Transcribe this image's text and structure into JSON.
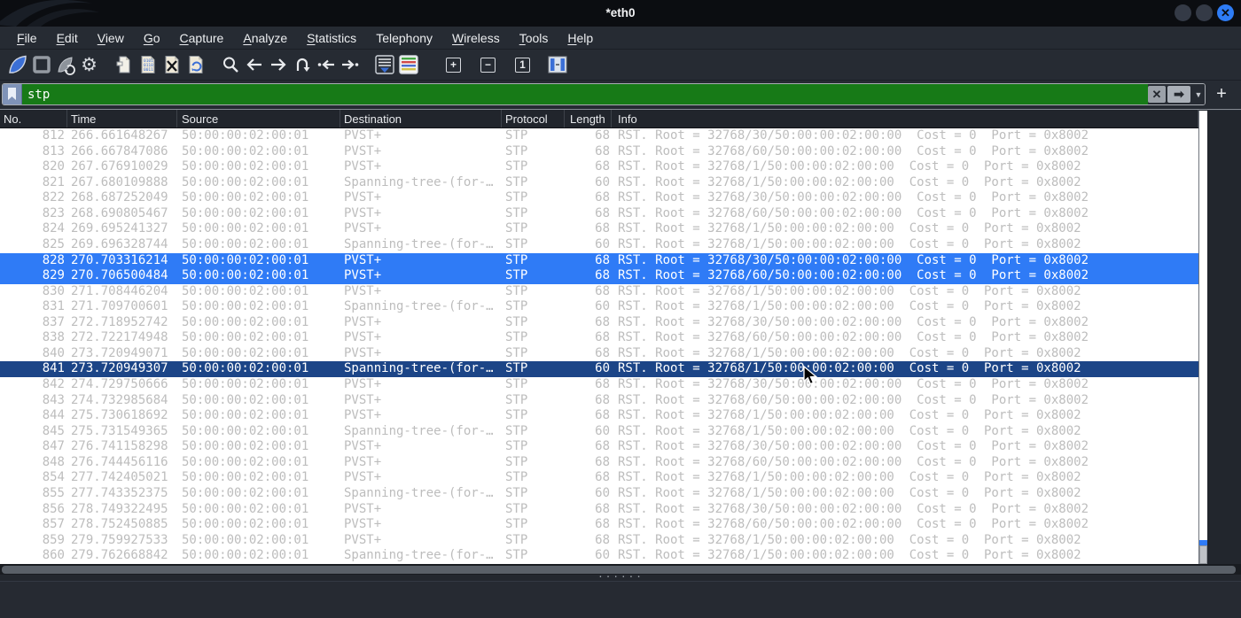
{
  "window": {
    "title": "*eth0",
    "controls": [
      "minimize",
      "maximize",
      "close"
    ],
    "close_glyph": "✕"
  },
  "menu": {
    "items": [
      {
        "label": "File",
        "mnemonic": 0
      },
      {
        "label": "Edit",
        "mnemonic": 0
      },
      {
        "label": "View",
        "mnemonic": 0
      },
      {
        "label": "Go",
        "mnemonic": 0
      },
      {
        "label": "Capture",
        "mnemonic": 0
      },
      {
        "label": "Analyze",
        "mnemonic": 0
      },
      {
        "label": "Statistics",
        "mnemonic": 0
      },
      {
        "label": "Telephony",
        "mnemonic": -1
      },
      {
        "label": "Wireless",
        "mnemonic": 0
      },
      {
        "label": "Tools",
        "mnemonic": 0
      },
      {
        "label": "Help",
        "mnemonic": 0
      }
    ]
  },
  "toolbar": {
    "buttons": [
      "start-capture",
      "stop-capture",
      "restart-capture",
      "capture-options",
      "open-file",
      "save-file",
      "close-file",
      "reload-file",
      "find-packet",
      "go-back",
      "go-forward",
      "go-to-packet",
      "go-first-packet",
      "go-last-packet",
      "auto-scroll",
      "colorize-packets",
      "zoom-in",
      "zoom-out",
      "zoom-original",
      "resize-columns"
    ],
    "zoom_in_glyph": "+",
    "zoom_out_glyph": "−",
    "zoom_original_glyph": "1",
    "gear_glyph": "⚙"
  },
  "filter": {
    "value": "stp",
    "clear_glyph": "✕",
    "apply_glyph": "➡",
    "caret_glyph": "▼",
    "add_glyph": "+"
  },
  "packet_table": {
    "columns": [
      "No.",
      "Time",
      "Source",
      "Destination",
      "Protocol",
      "Length",
      "Info"
    ],
    "rows": [
      {
        "no": "812",
        "time": "266.661648267",
        "source": "50:00:00:02:00:01",
        "destination": "PVST+",
        "protocol": "STP",
        "length": "68",
        "info": "RST. Root = 32768/30/50:00:00:02:00:00  Cost = 0  Port = 0x8002",
        "state": "normal"
      },
      {
        "no": "813",
        "time": "266.667847086",
        "source": "50:00:00:02:00:01",
        "destination": "PVST+",
        "protocol": "STP",
        "length": "68",
        "info": "RST. Root = 32768/60/50:00:00:02:00:00  Cost = 0  Port = 0x8002",
        "state": "normal"
      },
      {
        "no": "820",
        "time": "267.676910029",
        "source": "50:00:00:02:00:01",
        "destination": "PVST+",
        "protocol": "STP",
        "length": "68",
        "info": "RST. Root = 32768/1/50:00:00:02:00:00  Cost = 0  Port = 0x8002",
        "state": "normal"
      },
      {
        "no": "821",
        "time": "267.680109888",
        "source": "50:00:00:02:00:01",
        "destination": "Spanning-tree-(for-…",
        "protocol": "STP",
        "length": "60",
        "info": "RST. Root = 32768/1/50:00:00:02:00:00  Cost = 0  Port = 0x8002",
        "state": "normal"
      },
      {
        "no": "822",
        "time": "268.687252049",
        "source": "50:00:00:02:00:01",
        "destination": "PVST+",
        "protocol": "STP",
        "length": "68",
        "info": "RST. Root = 32768/30/50:00:00:02:00:00  Cost = 0  Port = 0x8002",
        "state": "normal"
      },
      {
        "no": "823",
        "time": "268.690805467",
        "source": "50:00:00:02:00:01",
        "destination": "PVST+",
        "protocol": "STP",
        "length": "68",
        "info": "RST. Root = 32768/60/50:00:00:02:00:00  Cost = 0  Port = 0x8002",
        "state": "normal"
      },
      {
        "no": "824",
        "time": "269.695241327",
        "source": "50:00:00:02:00:01",
        "destination": "PVST+",
        "protocol": "STP",
        "length": "68",
        "info": "RST. Root = 32768/1/50:00:00:02:00:00  Cost = 0  Port = 0x8002",
        "state": "normal"
      },
      {
        "no": "825",
        "time": "269.696328744",
        "source": "50:00:00:02:00:01",
        "destination": "Spanning-tree-(for-…",
        "protocol": "STP",
        "length": "60",
        "info": "RST. Root = 32768/1/50:00:00:02:00:00  Cost = 0  Port = 0x8002",
        "state": "normal"
      },
      {
        "no": "828",
        "time": "270.703316214",
        "source": "50:00:00:02:00:01",
        "destination": "PVST+",
        "protocol": "STP",
        "length": "68",
        "info": "RST. Root = 32768/30/50:00:00:02:00:00  Cost = 0  Port = 0x8002",
        "state": "selected"
      },
      {
        "no": "829",
        "time": "270.706500484",
        "source": "50:00:00:02:00:01",
        "destination": "PVST+",
        "protocol": "STP",
        "length": "68",
        "info": "RST. Root = 32768/60/50:00:00:02:00:00  Cost = 0  Port = 0x8002",
        "state": "selected"
      },
      {
        "no": "830",
        "time": "271.708446204",
        "source": "50:00:00:02:00:01",
        "destination": "PVST+",
        "protocol": "STP",
        "length": "68",
        "info": "RST. Root = 32768/1/50:00:00:02:00:00  Cost = 0  Port = 0x8002",
        "state": "normal"
      },
      {
        "no": "831",
        "time": "271.709700601",
        "source": "50:00:00:02:00:01",
        "destination": "Spanning-tree-(for-…",
        "protocol": "STP",
        "length": "60",
        "info": "RST. Root = 32768/1/50:00:00:02:00:00  Cost = 0  Port = 0x8002",
        "state": "normal"
      },
      {
        "no": "837",
        "time": "272.718952742",
        "source": "50:00:00:02:00:01",
        "destination": "PVST+",
        "protocol": "STP",
        "length": "68",
        "info": "RST. Root = 32768/30/50:00:00:02:00:00  Cost = 0  Port = 0x8002",
        "state": "normal"
      },
      {
        "no": "838",
        "time": "272.722174948",
        "source": "50:00:00:02:00:01",
        "destination": "PVST+",
        "protocol": "STP",
        "length": "68",
        "info": "RST. Root = 32768/60/50:00:00:02:00:00  Cost = 0  Port = 0x8002",
        "state": "normal"
      },
      {
        "no": "840",
        "time": "273.720949071",
        "source": "50:00:00:02:00:01",
        "destination": "PVST+",
        "protocol": "STP",
        "length": "68",
        "info": "RST. Root = 32768/1/50:00:00:02:00:00  Cost = 0  Port = 0x8002",
        "state": "normal"
      },
      {
        "no": "841",
        "time": "273.720949307",
        "source": "50:00:00:02:00:01",
        "destination": "Spanning-tree-(for-…",
        "protocol": "STP",
        "length": "60",
        "info": "RST. Root = 32768/1/50:00:00:02:00:00  Cost = 0  Port = 0x8002",
        "state": "focused"
      },
      {
        "no": "842",
        "time": "274.729750666",
        "source": "50:00:00:02:00:01",
        "destination": "PVST+",
        "protocol": "STP",
        "length": "68",
        "info": "RST. Root = 32768/30/50:00:00:02:00:00  Cost = 0  Port = 0x8002",
        "state": "normal"
      },
      {
        "no": "843",
        "time": "274.732985684",
        "source": "50:00:00:02:00:01",
        "destination": "PVST+",
        "protocol": "STP",
        "length": "68",
        "info": "RST. Root = 32768/60/50:00:00:02:00:00  Cost = 0  Port = 0x8002",
        "state": "normal"
      },
      {
        "no": "844",
        "time": "275.730618692",
        "source": "50:00:00:02:00:01",
        "destination": "PVST+",
        "protocol": "STP",
        "length": "68",
        "info": "RST. Root = 32768/1/50:00:00:02:00:00  Cost = 0  Port = 0x8002",
        "state": "normal"
      },
      {
        "no": "845",
        "time": "275.731549365",
        "source": "50:00:00:02:00:01",
        "destination": "Spanning-tree-(for-…",
        "protocol": "STP",
        "length": "60",
        "info": "RST. Root = 32768/1/50:00:00:02:00:00  Cost = 0  Port = 0x8002",
        "state": "normal"
      },
      {
        "no": "847",
        "time": "276.741158298",
        "source": "50:00:00:02:00:01",
        "destination": "PVST+",
        "protocol": "STP",
        "length": "68",
        "info": "RST. Root = 32768/30/50:00:00:02:00:00  Cost = 0  Port = 0x8002",
        "state": "normal"
      },
      {
        "no": "848",
        "time": "276.744456116",
        "source": "50:00:00:02:00:01",
        "destination": "PVST+",
        "protocol": "STP",
        "length": "68",
        "info": "RST. Root = 32768/60/50:00:00:02:00:00  Cost = 0  Port = 0x8002",
        "state": "normal"
      },
      {
        "no": "854",
        "time": "277.742405021",
        "source": "50:00:00:02:00:01",
        "destination": "PVST+",
        "protocol": "STP",
        "length": "68",
        "info": "RST. Root = 32768/1/50:00:00:02:00:00  Cost = 0  Port = 0x8002",
        "state": "normal"
      },
      {
        "no": "855",
        "time": "277.743352375",
        "source": "50:00:00:02:00:01",
        "destination": "Spanning-tree-(for-…",
        "protocol": "STP",
        "length": "60",
        "info": "RST. Root = 32768/1/50:00:00:02:00:00  Cost = 0  Port = 0x8002",
        "state": "normal"
      },
      {
        "no": "856",
        "time": "278.749322495",
        "source": "50:00:00:02:00:01",
        "destination": "PVST+",
        "protocol": "STP",
        "length": "68",
        "info": "RST. Root = 32768/30/50:00:00:02:00:00  Cost = 0  Port = 0x8002",
        "state": "normal"
      },
      {
        "no": "857",
        "time": "278.752450885",
        "source": "50:00:00:02:00:01",
        "destination": "PVST+",
        "protocol": "STP",
        "length": "68",
        "info": "RST. Root = 32768/60/50:00:00:02:00:00  Cost = 0  Port = 0x8002",
        "state": "normal"
      },
      {
        "no": "859",
        "time": "279.759927533",
        "source": "50:00:00:02:00:01",
        "destination": "PVST+",
        "protocol": "STP",
        "length": "68",
        "info": "RST. Root = 32768/1/50:00:00:02:00:00  Cost = 0  Port = 0x8002",
        "state": "normal"
      },
      {
        "no": "860",
        "time": "279.762668842",
        "source": "50:00:00:02:00:01",
        "destination": "Spanning-tree-(for-…",
        "protocol": "STP",
        "length": "60",
        "info": "RST. Root = 32768/1/50:00:00:02:00:00  Cost = 0  Port = 0x8002",
        "state": "normal"
      }
    ]
  },
  "splitter_dots": "······",
  "colors": {
    "filter_valid_bg": "#177a17",
    "selection_blue": "#2f7bf6",
    "focused_selection_navy": "#1c4587",
    "row_text_gray": "#bdbdbd",
    "titlebar_bg": "#0b0d11",
    "chrome_bg": "#262b33"
  }
}
